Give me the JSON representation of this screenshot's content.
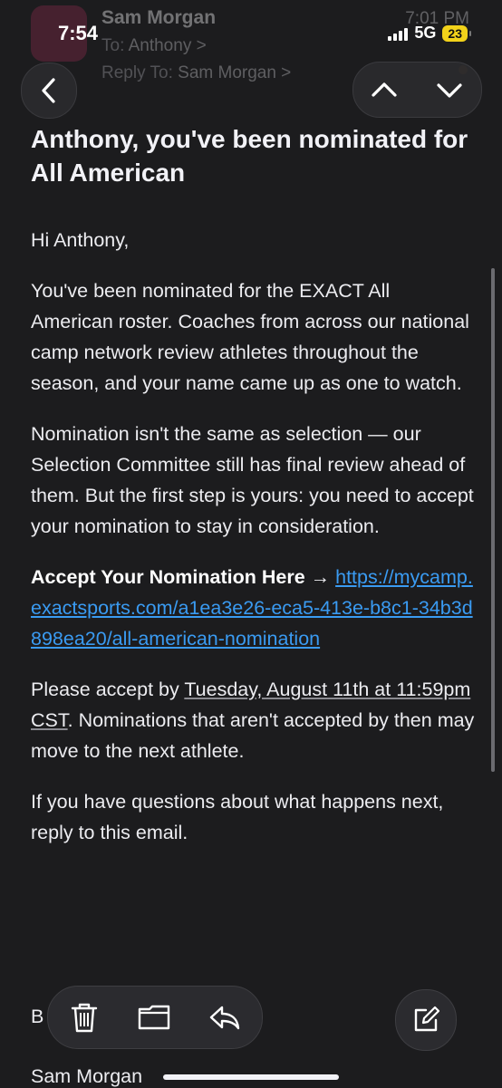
{
  "status_bar": {
    "time": "7:54",
    "network": "5G",
    "battery": "23"
  },
  "header": {
    "sender": "Sam Morgan",
    "time": "7:01 PM",
    "to_label": "To:",
    "to_value": "Anthony >",
    "reply_to_label": "Reply To:",
    "reply_to_value": "Sam Morgan >"
  },
  "email": {
    "subject": "Anthony, you've been nominated for All American",
    "greeting": "Hi Anthony,",
    "para1": "You've been nominated for the EXACT All American roster. Coaches from across our national camp network review athletes throughout the season, and your name came up as one to watch.",
    "para2": "Nomination isn't the same as selection — our Selection Committee still has final review ahead of them. But the first step is yours: you need to accept your nomination to stay in consideration.",
    "accept_label": "Accept Your Nomination Here",
    "accept_arrow": " → ",
    "accept_link": "https://mycamp.exactsports.com/a1ea3e26-eca5-413e-b8c1-34b3d898ea20/all-american-nomination",
    "deadline_pre": "Please accept by ",
    "deadline_date": "Tuesday, August 11th at 11:59pm CST",
    "deadline_post": ". Nominations that aren't accepted by then may move to the next athlete.",
    "questions": "If you have questions about what happens next, reply to this email.",
    "signoff_partial": "B",
    "signature": "Sam Morgan"
  },
  "icons": {
    "back": "chevron-left-icon",
    "up": "chevron-up-icon",
    "down": "chevron-down-icon",
    "trash": "trash-icon",
    "folder": "folder-icon",
    "reply": "reply-icon",
    "compose": "compose-icon"
  },
  "colors": {
    "background": "#1c1c1e",
    "link": "#3a9bf2",
    "battery": "#f2d21a",
    "avatar": "#8a2b4c"
  }
}
